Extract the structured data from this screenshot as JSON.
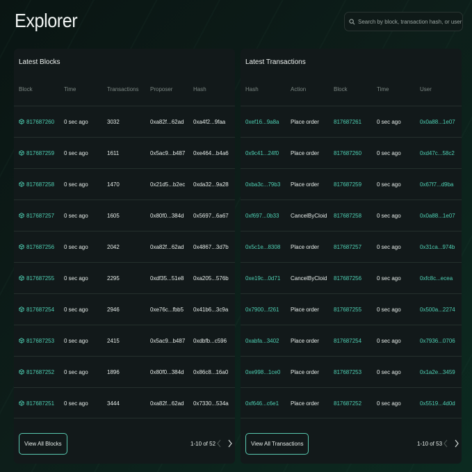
{
  "header": {
    "title": "Explorer",
    "search_placeholder": "Search by block, transaction hash, or user address"
  },
  "blocks": {
    "title": "Latest Blocks",
    "columns": [
      "Block",
      "Time",
      "Transactions",
      "Proposer",
      "Hash"
    ],
    "rows": [
      {
        "block": "817687260",
        "time": "0 sec ago",
        "txs": "3032",
        "proposer": "0xa82f...62ad",
        "hash": "0xa4f2...9faa"
      },
      {
        "block": "817687259",
        "time": "0 sec ago",
        "txs": "1611",
        "proposer": "0x5ac9...b487",
        "hash": "0xe464...b4a6"
      },
      {
        "block": "817687258",
        "time": "0 sec ago",
        "txs": "1470",
        "proposer": "0x21d5...b2ec",
        "hash": "0xda32...9a28"
      },
      {
        "block": "817687257",
        "time": "0 sec ago",
        "txs": "1605",
        "proposer": "0x80f0...384d",
        "hash": "0x5697...6a67"
      },
      {
        "block": "817687256",
        "time": "0 sec ago",
        "txs": "2042",
        "proposer": "0xa82f...62ad",
        "hash": "0x4867...3d7b"
      },
      {
        "block": "817687255",
        "time": "0 sec ago",
        "txs": "2295",
        "proposer": "0xdf35...51e8",
        "hash": "0xa205...576b"
      },
      {
        "block": "817687254",
        "time": "0 sec ago",
        "txs": "2946",
        "proposer": "0xe76c...fbb5",
        "hash": "0x41b6...3c9a"
      },
      {
        "block": "817687253",
        "time": "0 sec ago",
        "txs": "2415",
        "proposer": "0x5ac9...b487",
        "hash": "0xdbfb...c596"
      },
      {
        "block": "817687252",
        "time": "0 sec ago",
        "txs": "1896",
        "proposer": "0x80f0...384d",
        "hash": "0x86c8...16a0"
      },
      {
        "block": "817687251",
        "time": "0 sec ago",
        "txs": "3444",
        "proposer": "0xa82f...62ad",
        "hash": "0x7330...534a"
      }
    ],
    "view_all": "View All Blocks",
    "pagination": "1-10 of 52"
  },
  "transactions": {
    "title": "Latest Transactions",
    "columns": [
      "Hash",
      "Action",
      "Block",
      "Time",
      "User"
    ],
    "rows": [
      {
        "hash": "0xef16...9a8a",
        "action": "Place order",
        "block": "817687261",
        "time": "0 sec ago",
        "user": "0x0a88...1e07"
      },
      {
        "hash": "0x9c41...24f0",
        "action": "Place order",
        "block": "817687260",
        "time": "0 sec ago",
        "user": "0xd47c...58c2"
      },
      {
        "hash": "0xba3c...79b3",
        "action": "Place order",
        "block": "817687259",
        "time": "0 sec ago",
        "user": "0x67f7...d9ba"
      },
      {
        "hash": "0xf697...0b33",
        "action": "CancelByCloid",
        "block": "817687258",
        "time": "0 sec ago",
        "user": "0x0a88...1e07"
      },
      {
        "hash": "0x5c1e...8308",
        "action": "Place order",
        "block": "817687257",
        "time": "0 sec ago",
        "user": "0x31ca...974b"
      },
      {
        "hash": "0xe19c...0d71",
        "action": "CancelByCloid",
        "block": "817687256",
        "time": "0 sec ago",
        "user": "0xfc8c...ecea"
      },
      {
        "hash": "0x7900...f261",
        "action": "Place order",
        "block": "817687255",
        "time": "0 sec ago",
        "user": "0x500a...2274"
      },
      {
        "hash": "0xabfa...3402",
        "action": "Place order",
        "block": "817687254",
        "time": "0 sec ago",
        "user": "0x7936...0706"
      },
      {
        "hash": "0xe998...1ce0",
        "action": "Place order",
        "block": "817687253",
        "time": "0 sec ago",
        "user": "0x1a2e...3459"
      },
      {
        "hash": "0xf646...c6e1",
        "action": "Place order",
        "block": "817687252",
        "time": "0 sec ago",
        "user": "0x5519...4d0d"
      }
    ],
    "view_all": "View All Transactions",
    "pagination": "1-10 of 53"
  },
  "colors": {
    "accent": "#4fd1b4",
    "panel": "#12191a",
    "border": "#25302d"
  },
  "icons": {
    "block_row": "cube-icon",
    "search": "search-icon",
    "prev": "chevron-left-icon",
    "next": "chevron-right-icon"
  }
}
